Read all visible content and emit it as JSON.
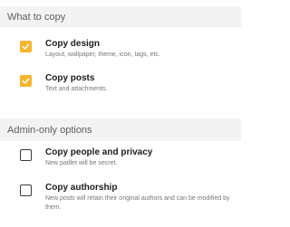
{
  "colors": {
    "checked_fill": "#f5b52e",
    "unchecked_border": "#3a3a3a",
    "section_header_bg": "#f3f3f3"
  },
  "sections": [
    {
      "header": "What to copy",
      "options": [
        {
          "title": "Copy design",
          "description": "Layout, wallpaper, theme, icon, tags, etc.",
          "checked": true
        },
        {
          "title": "Copy posts",
          "description": "Text and attachments.",
          "checked": true
        }
      ]
    },
    {
      "header": "Admin-only options",
      "options": [
        {
          "title": "Copy people and privacy",
          "description": "New padlet will be secret.",
          "checked": false
        },
        {
          "title": "Copy authorship",
          "description": "New posts will retain their original authors and can be modified by them.",
          "checked": false
        }
      ]
    }
  ]
}
